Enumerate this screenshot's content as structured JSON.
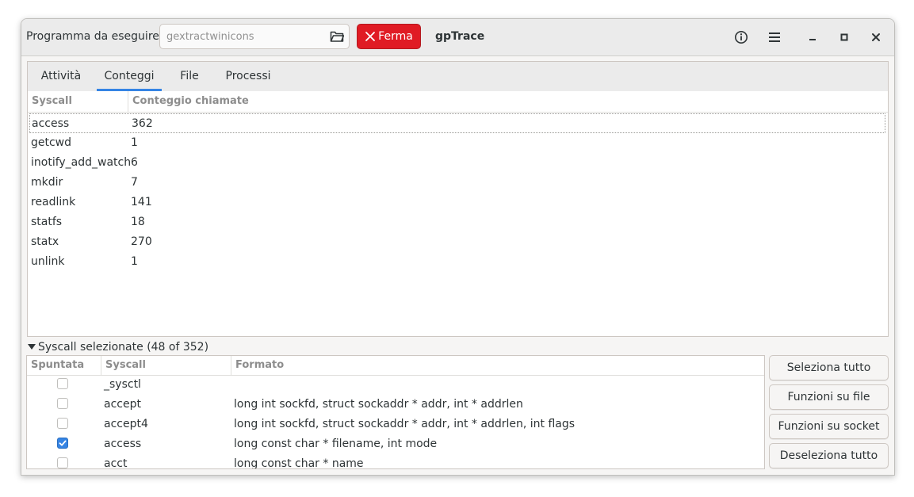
{
  "headerbar": {
    "program_label": "Programma da eseguire:",
    "program_placeholder": "gextractwinicons",
    "stop_label": "Ferma",
    "title": "gpTrace"
  },
  "tabs": [
    {
      "label": "Attività",
      "active": false
    },
    {
      "label": "Conteggi",
      "active": true
    },
    {
      "label": "File",
      "active": false
    },
    {
      "label": "Processi",
      "active": false
    }
  ],
  "counts": {
    "headers": [
      "Syscall",
      "Conteggio chiamate"
    ],
    "rows": [
      {
        "syscall": "access",
        "count": "362"
      },
      {
        "syscall": "getcwd",
        "count": "1"
      },
      {
        "syscall": "inotify_add_watch",
        "count": "6"
      },
      {
        "syscall": "mkdir",
        "count": "7"
      },
      {
        "syscall": "readlink",
        "count": "141"
      },
      {
        "syscall": "statfs",
        "count": "18"
      },
      {
        "syscall": "statx",
        "count": "270"
      },
      {
        "syscall": "unlink",
        "count": "1"
      }
    ]
  },
  "selected": {
    "expander_label": "Syscall selezionate (48 of 352)",
    "headers": [
      "Spuntata",
      "Syscall",
      "Formato"
    ],
    "rows": [
      {
        "checked": false,
        "syscall": "_sysctl",
        "format": ""
      },
      {
        "checked": false,
        "syscall": "accept",
        "format": "long int sockfd, struct sockaddr * addr, int * addrlen"
      },
      {
        "checked": false,
        "syscall": "accept4",
        "format": "long int sockfd, struct sockaddr * addr, int * addrlen, int flags"
      },
      {
        "checked": true,
        "syscall": "access",
        "format": "long const char * filename, int mode"
      },
      {
        "checked": false,
        "syscall": "acct",
        "format": "long const char * name"
      }
    ]
  },
  "buttons": {
    "select_all": "Seleziona tutto",
    "file_functions": "Funzioni su file",
    "socket_functions": "Funzioni su socket",
    "deselect_all": "Deseleziona tutto"
  },
  "colors": {
    "accent": "#3584e4",
    "stop": "#e01b24"
  }
}
